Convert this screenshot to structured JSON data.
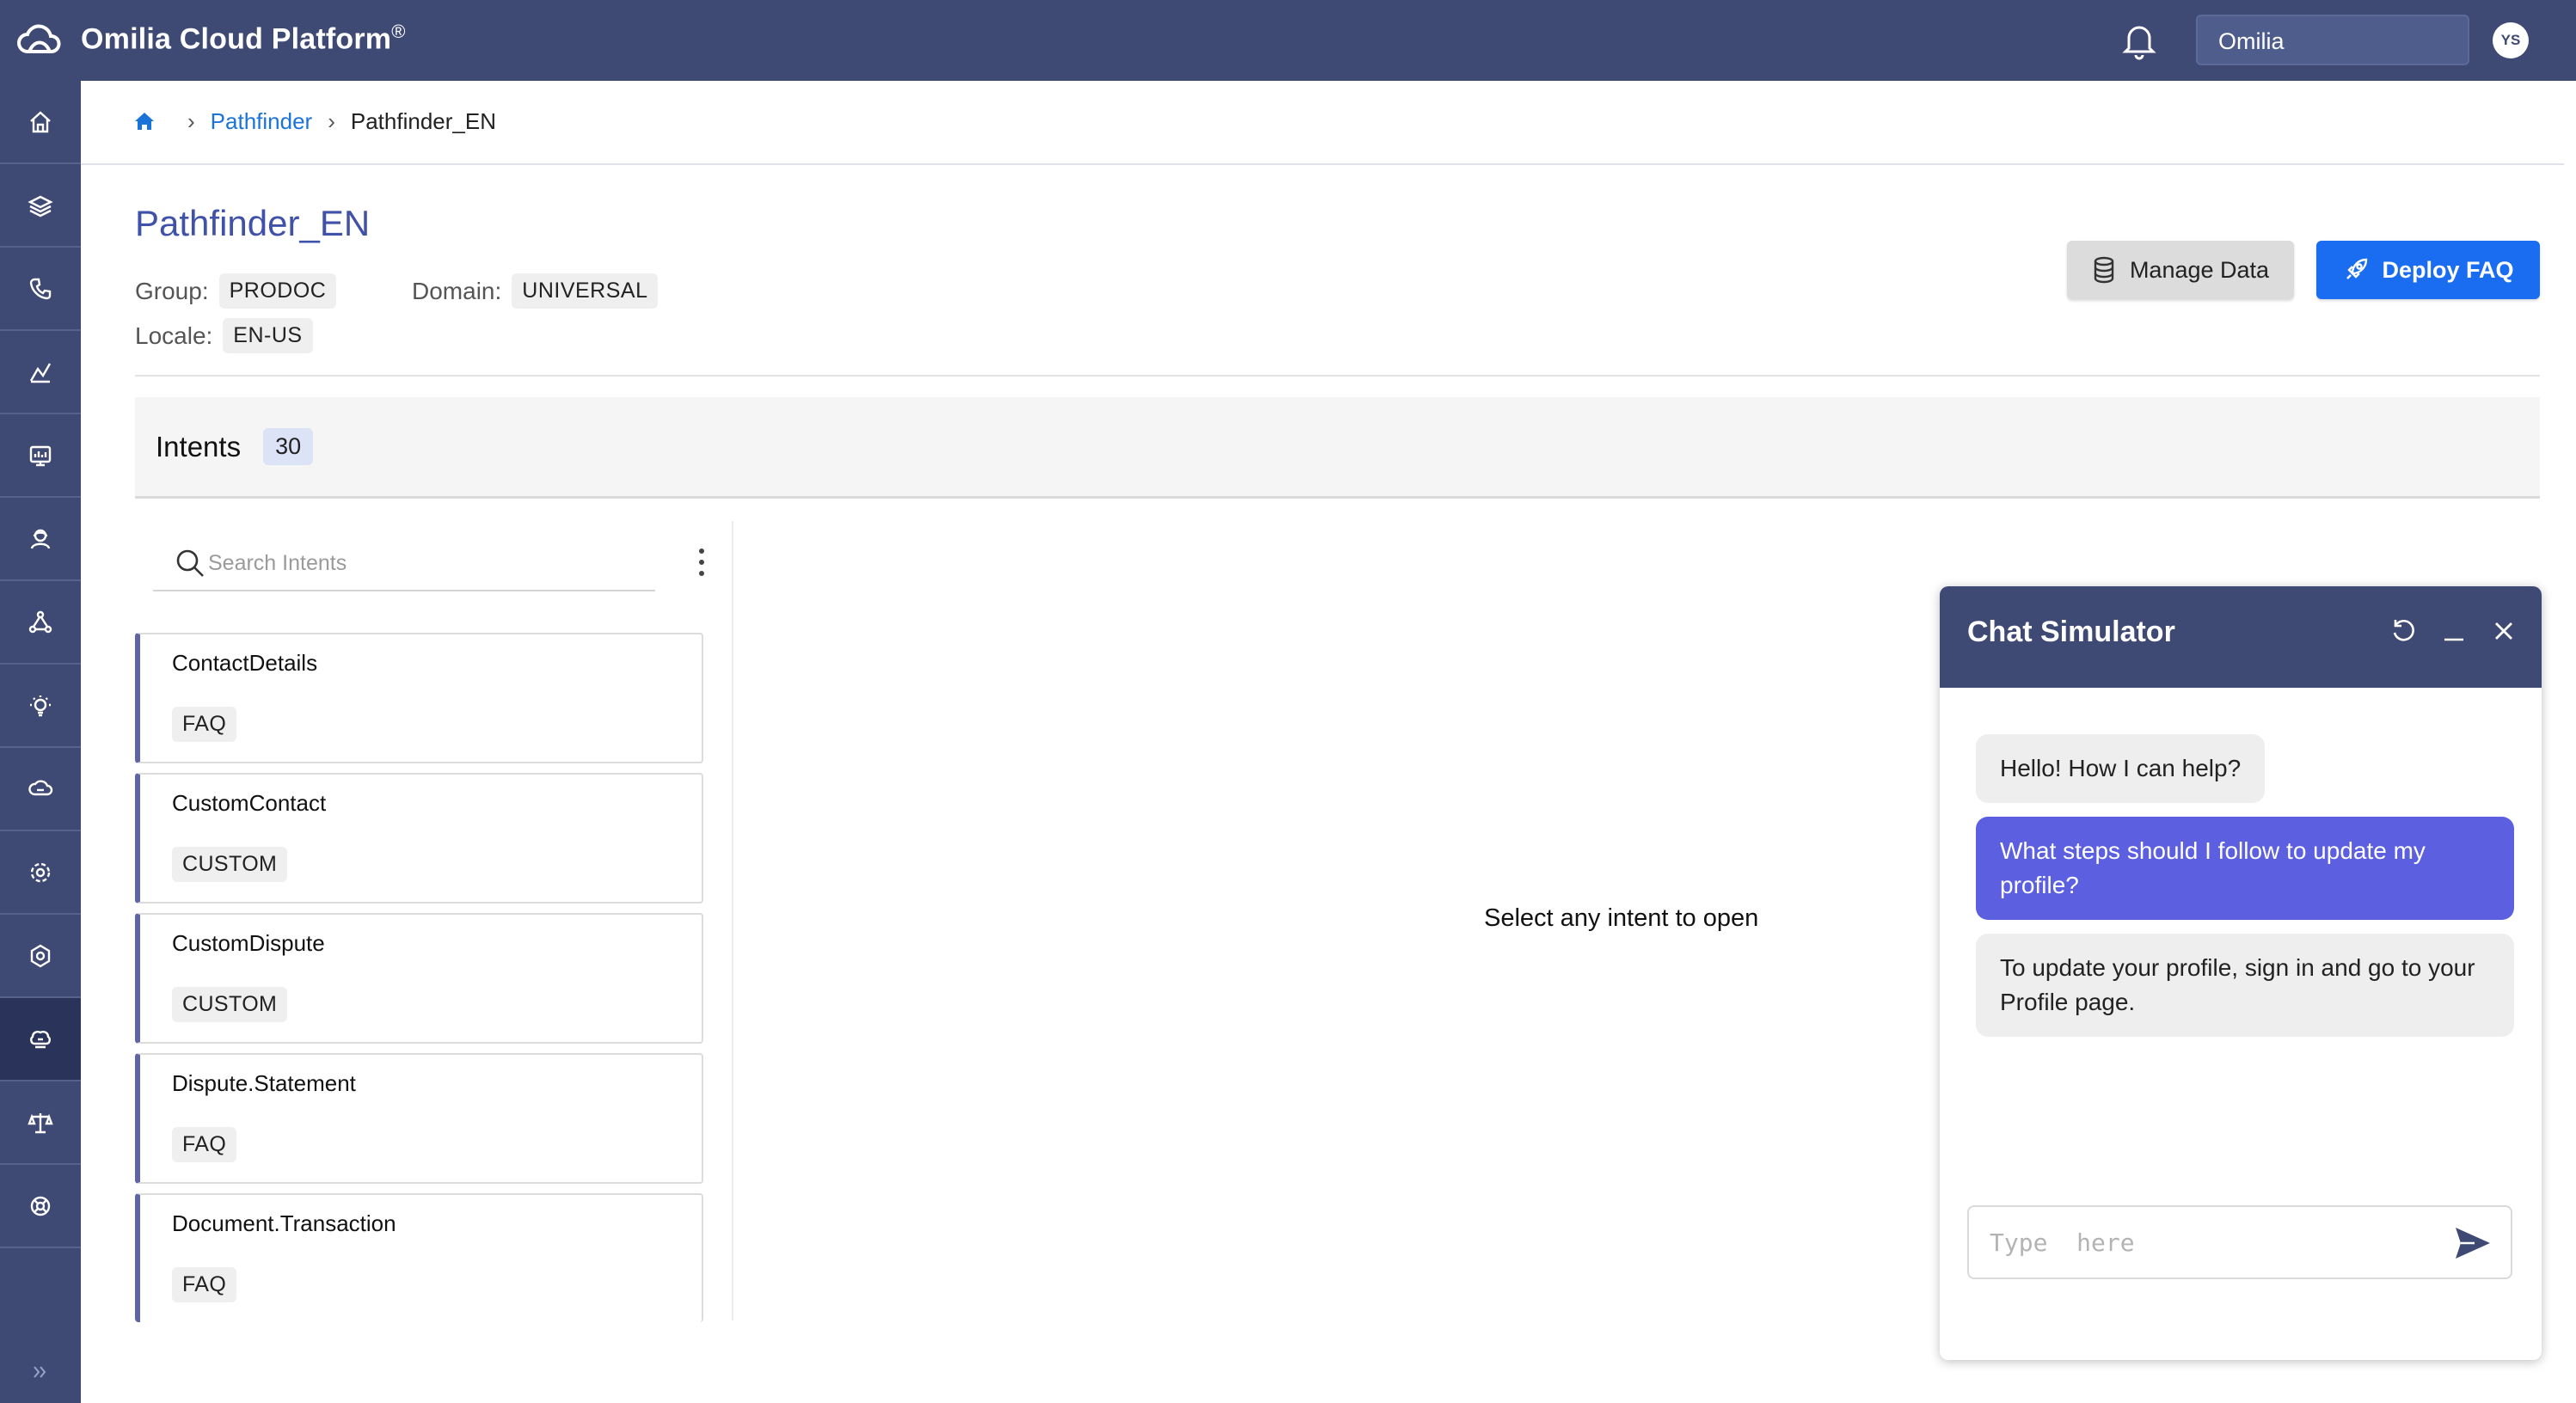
{
  "app": {
    "brand": "Omilia Cloud Platform",
    "brand_mark": "®",
    "org_selector": "Omilia",
    "avatar_initials": "YS"
  },
  "sidebar": {
    "items": [
      {
        "icon": "home-icon"
      },
      {
        "icon": "layers-icon"
      },
      {
        "icon": "phone-icon"
      },
      {
        "icon": "analytics-icon"
      },
      {
        "icon": "monitor-icon"
      },
      {
        "icon": "agent-icon"
      },
      {
        "icon": "network-icon"
      },
      {
        "icon": "lightbulb-icon"
      },
      {
        "icon": "cloud-icon"
      },
      {
        "icon": "settings-icon"
      },
      {
        "icon": "hexagon-gear-icon"
      },
      {
        "icon": "brain-icon",
        "active": true
      },
      {
        "icon": "scale-icon"
      },
      {
        "icon": "support-icon"
      }
    ],
    "expand_icon": "double-chevron-right-icon"
  },
  "breadcrumb": {
    "items": [
      "Pathfinder",
      "Pathfinder_EN"
    ]
  },
  "page": {
    "title": "Pathfinder_EN",
    "group_label": "Group:",
    "group_value": "PRODOC",
    "domain_label": "Domain:",
    "domain_value": "UNIVERSAL",
    "locale_label": "Locale:",
    "locale_value": "EN-US",
    "manage_data_label": "Manage Data",
    "deploy_label": "Deploy FAQ"
  },
  "intents": {
    "label": "Intents",
    "count": "30",
    "search_placeholder": "Search Intents",
    "items": [
      {
        "name": "ContactDetails",
        "tag": "FAQ"
      },
      {
        "name": "CustomContact",
        "tag": "CUSTOM"
      },
      {
        "name": "CustomDispute",
        "tag": "CUSTOM"
      },
      {
        "name": "Dispute.Statement",
        "tag": "FAQ"
      },
      {
        "name": "Document.Transaction",
        "tag": "FAQ"
      }
    ],
    "empty_message": "Select any intent to open"
  },
  "chat": {
    "title": "Chat Simulator",
    "messages": [
      {
        "from": "bot",
        "text": "Hello! How I can help?"
      },
      {
        "from": "user",
        "text": "What steps should I follow to update my profile?"
      },
      {
        "from": "bot",
        "text": "To update your profile, sign in and go to your Profile page."
      }
    ],
    "input_placeholder": "Type  here"
  },
  "colors": {
    "header": "#3f4a74",
    "primary": "#1a6cf0",
    "user_bubble": "#5b5fe0",
    "card_accent": "#5d64a8"
  }
}
